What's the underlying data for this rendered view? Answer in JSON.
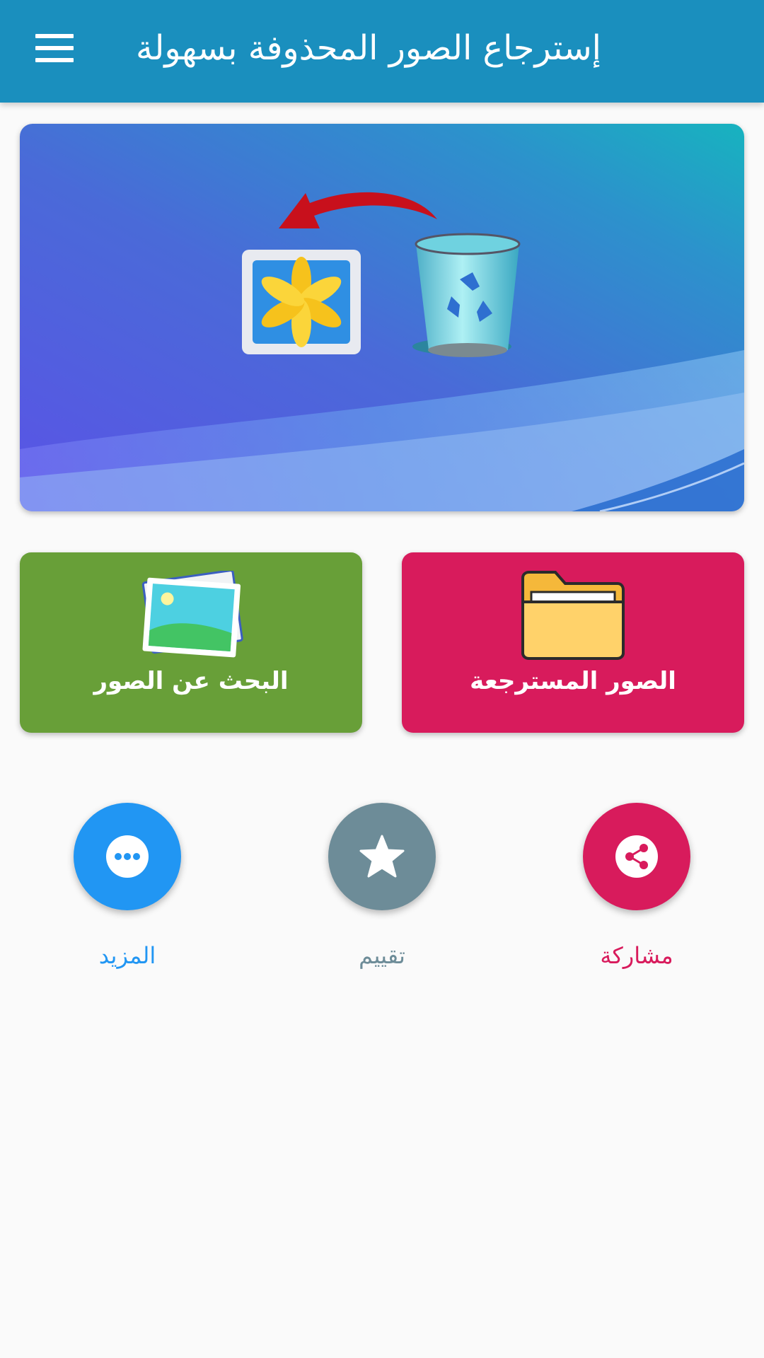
{
  "app_bar": {
    "title": "إسترجاع الصور المحذوفة بسهولة",
    "menu_icon": "hamburger-menu-icon",
    "background": "#1a8fbe"
  },
  "banner": {
    "illustration": "restore-photos-from-recycle-bin",
    "icons": [
      "photo-gallery-icon",
      "recycle-bin-icon",
      "restore-arrow-icon"
    ]
  },
  "cards": {
    "search": {
      "label": "البحث عن الصور",
      "icon": "photos-icon",
      "color": "#689f38"
    },
    "recovered": {
      "label": "الصور المسترجعة",
      "icon": "folder-icon",
      "color": "#d81b5c"
    }
  },
  "actions": {
    "more": {
      "label": "المزيد",
      "icon": "more-dots-icon",
      "color": "#2196f3"
    },
    "rate": {
      "label": "تقييم",
      "icon": "star-icon",
      "color": "#6d8c98"
    },
    "share": {
      "label": "مشاركة",
      "icon": "share-icon",
      "color": "#d81b5c"
    }
  }
}
